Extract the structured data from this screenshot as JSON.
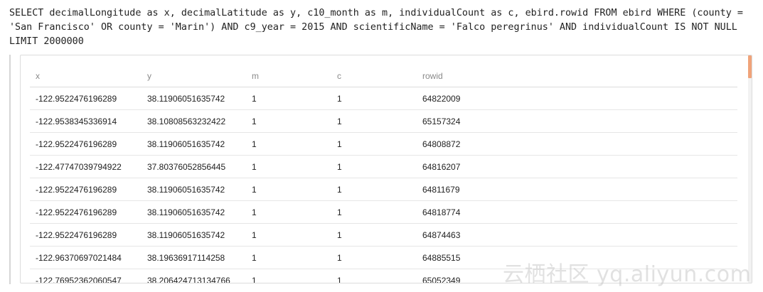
{
  "query": {
    "line1": "SELECT decimalLongitude as x, decimalLatitude as y, c10_month as m, individualCount as c, ebird.rowid FROM ebird WHERE (county =",
    "line2": "'San Francisco' OR county = 'Marin') AND c9_year = 2015 AND scientificName = 'Falco peregrinus' AND individualCount IS NOT NULL",
    "line3": "LIMIT 2000000"
  },
  "results": {
    "columns": [
      "x",
      "y",
      "m",
      "c",
      "rowid"
    ],
    "rows": [
      [
        "-122.9522476196289",
        "38.11906051635742",
        "1",
        "1",
        "64822009"
      ],
      [
        "-122.9538345336914",
        "38.10808563232422",
        "1",
        "1",
        "65157324"
      ],
      [
        "-122.9522476196289",
        "38.11906051635742",
        "1",
        "1",
        "64808872"
      ],
      [
        "-122.47747039794922",
        "37.80376052856445",
        "1",
        "1",
        "64816207"
      ],
      [
        "-122.9522476196289",
        "38.11906051635742",
        "1",
        "1",
        "64811679"
      ],
      [
        "-122.9522476196289",
        "38.11906051635742",
        "1",
        "1",
        "64818774"
      ],
      [
        "-122.9522476196289",
        "38.11906051635742",
        "1",
        "1",
        "64874463"
      ],
      [
        "-122.96370697021484",
        "38.19636917114258",
        "1",
        "1",
        "64885515"
      ],
      [
        "-122.76952362060547",
        "38.206424713134766",
        "1",
        "1",
        "65052349"
      ]
    ]
  },
  "colors": {
    "scrollbar_thumb": "#f0a37a",
    "header_text": "#8a8a8a",
    "cell_text": "#222222"
  },
  "watermark": "云栖社区 yq.aliyun.com"
}
